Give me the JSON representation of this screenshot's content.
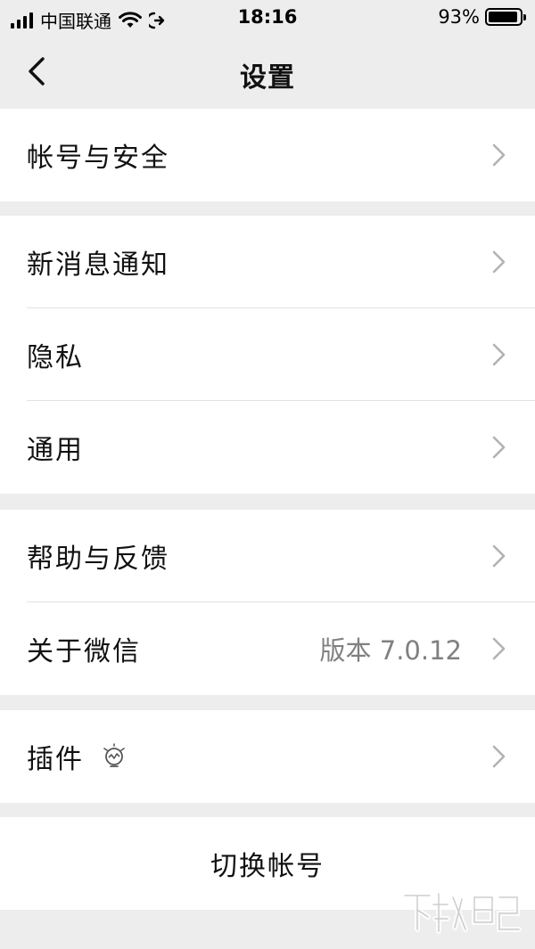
{
  "status_bar": {
    "carrier": "中国联通",
    "time": "18:16",
    "battery_percent": "93%",
    "battery_level": 0.93
  },
  "nav": {
    "title": "设置",
    "back_icon": "chevron-left-icon"
  },
  "groups": [
    {
      "items": [
        {
          "label": "帐号与安全"
        }
      ]
    },
    {
      "items": [
        {
          "label": "新消息通知"
        },
        {
          "label": "隐私"
        },
        {
          "label": "通用"
        }
      ]
    },
    {
      "items": [
        {
          "label": "帮助与反馈"
        },
        {
          "label": "关于微信",
          "value": "版本 7.0.12"
        }
      ]
    },
    {
      "items": [
        {
          "label": "插件",
          "icon": "lightbulb-icon"
        }
      ]
    }
  ],
  "switch_account": "切换帐号",
  "colors": {
    "background": "#ededed",
    "surface": "#ffffff",
    "secondary_text": "#808080",
    "chevron": "#b2b2b2"
  }
}
